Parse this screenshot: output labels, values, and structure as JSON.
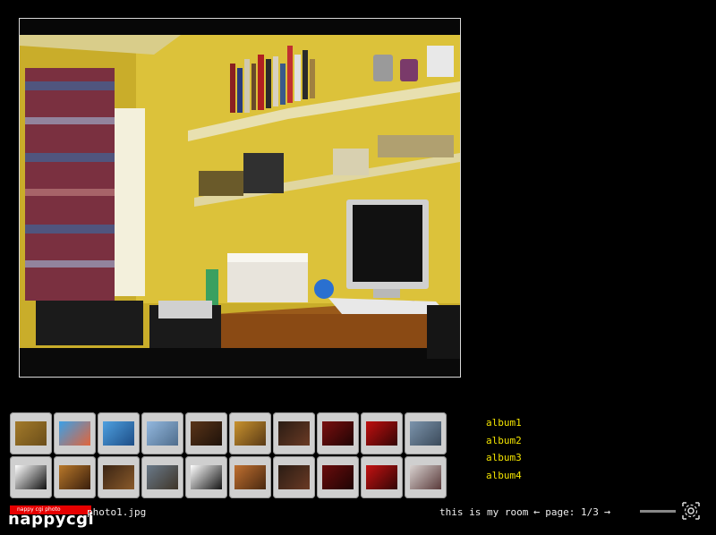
{
  "main_photo": {
    "alt": "photo1.jpg"
  },
  "thumbnails": [
    {
      "colors": [
        "#a37a2a",
        "#6b4e1a"
      ]
    },
    {
      "colors": [
        "#3aa0e8",
        "#e2643a"
      ]
    },
    {
      "colors": [
        "#4ea0e0",
        "#1d4d86"
      ]
    },
    {
      "colors": [
        "#93b8df",
        "#4f6d8c"
      ]
    },
    {
      "colors": [
        "#5a3418",
        "#1e120a"
      ]
    },
    {
      "colors": [
        "#c8922e",
        "#5a3a16"
      ]
    },
    {
      "colors": [
        "#2a1c14",
        "#6a3a24"
      ]
    },
    {
      "colors": [
        "#7a0f0f",
        "#200404"
      ]
    },
    {
      "colors": [
        "#c01010",
        "#350505"
      ]
    },
    {
      "colors": [
        "#7c94ac",
        "#3b4a5a"
      ]
    },
    {
      "colors": [
        "#ffffff",
        "#111111"
      ]
    },
    {
      "colors": [
        "#b8782a",
        "#3a1e0c"
      ]
    },
    {
      "colors": [
        "#3a2414",
        "#8a5a2a"
      ]
    },
    {
      "colors": [
        "#6a7a8a",
        "#3e3428"
      ]
    },
    {
      "colors": [
        "#ffffff",
        "#151515"
      ]
    },
    {
      "colors": [
        "#c07030",
        "#4a2810"
      ]
    },
    {
      "colors": [
        "#2a1c14",
        "#6a3a24"
      ]
    },
    {
      "colors": [
        "#6a0c0c",
        "#1e0404"
      ]
    },
    {
      "colors": [
        "#c41212",
        "#330505"
      ]
    },
    {
      "colors": [
        "#d8d2d0",
        "#5a3a3a"
      ]
    }
  ],
  "albums": [
    "album1",
    "album2",
    "album3",
    "album4"
  ],
  "logo": {
    "badge_text": "nappy cgi photo",
    "word": "nappycgi"
  },
  "filename": "photo1.jpg",
  "caption": "this is my room",
  "pager": {
    "prev_icon": "arrow-left-icon",
    "label": "page: 1/3",
    "next_icon": "arrow-right-icon"
  },
  "fullscreen_icon": "fullscreen-icon"
}
